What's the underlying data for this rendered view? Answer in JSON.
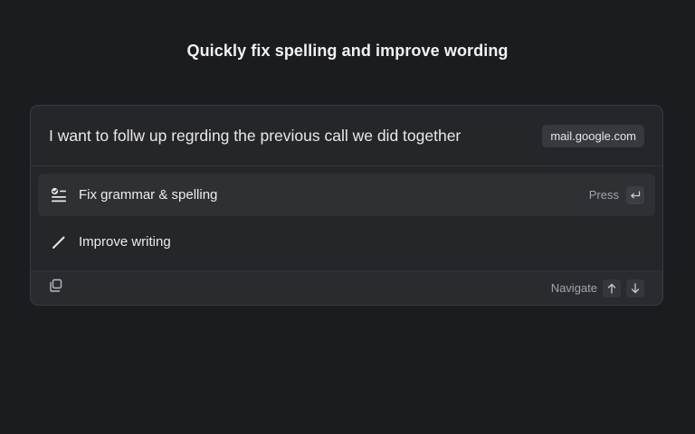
{
  "headline": "Quickly fix spelling and improve wording",
  "query": {
    "text": "I want to follw up regrding the previous call we did together",
    "context": "mail.google.com"
  },
  "actions": [
    {
      "label": "Fix grammar & spelling",
      "icon": "grammar-check-icon",
      "selected": true
    },
    {
      "label": "Improve writing",
      "icon": "pencil-icon",
      "selected": false
    }
  ],
  "selected_hint": {
    "label": "Press",
    "key_icon": "return-key-icon"
  },
  "footer": {
    "left_icon": "copy-icon",
    "navigate_label": "Navigate",
    "keys": [
      "arrow-up-icon",
      "arrow-down-icon"
    ]
  },
  "colors": {
    "background": "#1b1c20",
    "panel": "#25262a",
    "selected_row": "#2f3034",
    "badge": "#38393e"
  }
}
